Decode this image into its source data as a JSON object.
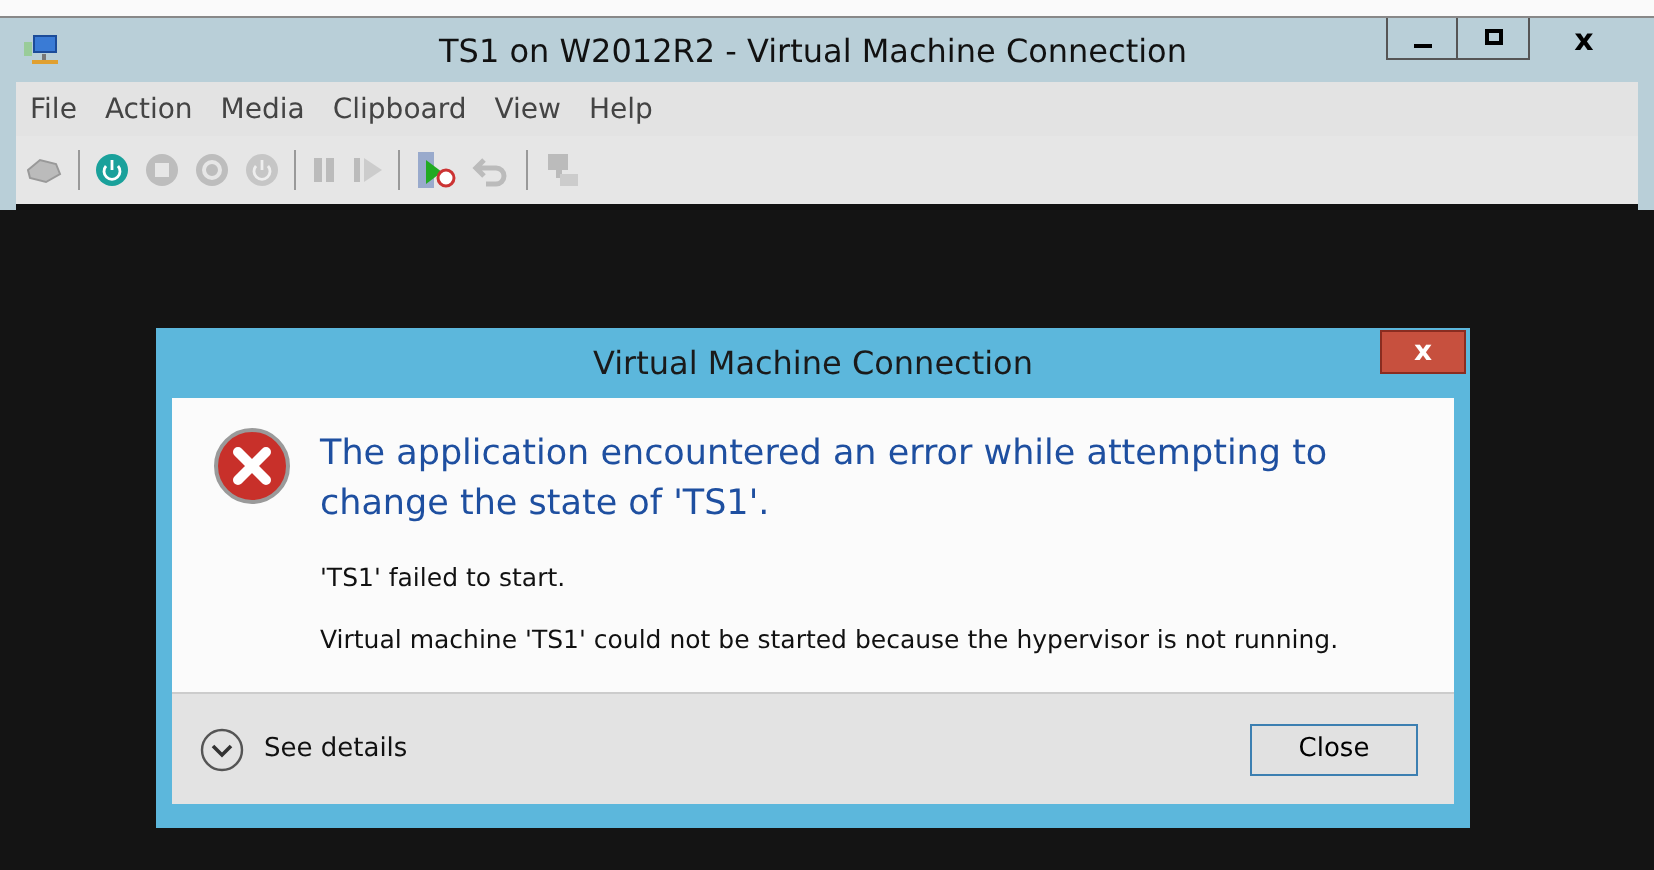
{
  "window": {
    "title": "TS1 on W2012R2 - Virtual Machine Connection"
  },
  "menu": [
    "File",
    "Action",
    "Media",
    "Clipboard",
    "View",
    "Help"
  ],
  "dialog": {
    "title": "Virtual Machine Connection",
    "close_glyph": "x",
    "heading": "The application encountered an error while attempting to change the state of 'TS1'.",
    "messages": [
      "'TS1' failed to start.",
      "Virtual machine 'TS1' could not be started because the hypervisor is not running."
    ],
    "details_label": "See details",
    "button": "Close"
  },
  "caption_buttons": [
    "x"
  ]
}
